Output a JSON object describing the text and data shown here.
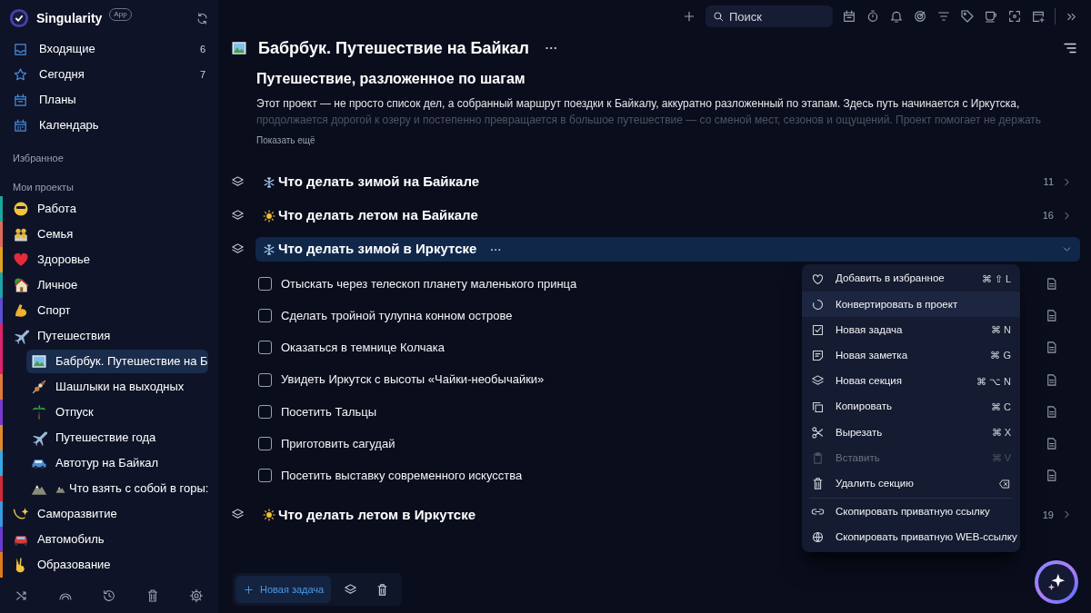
{
  "sidebar": {
    "app_name": "Singularity",
    "app_badge": "App",
    "nav": [
      {
        "label": "Входящие",
        "count": "6",
        "selected": false
      },
      {
        "label": "Сегодня",
        "count": "7",
        "selected": false
      },
      {
        "label": "Планы",
        "selected": false
      },
      {
        "label": "Календарь",
        "selected": false
      }
    ],
    "favorites_label": "Избранное",
    "projects_label": "Мои проекты",
    "projects": [
      {
        "label": "Работа",
        "color": "#19a89c",
        "selected": false
      },
      {
        "label": "Семья",
        "color": "#e06a5a",
        "selected": false
      },
      {
        "label": "Здоровье",
        "color": "#e0a21e",
        "selected": false
      },
      {
        "label": "Личное",
        "color": "#1fa3a8",
        "selected": false
      },
      {
        "label": "Спорт",
        "color": "#5a4fd0",
        "selected": false
      },
      {
        "label": "Путешествия",
        "color": "#e0216e",
        "selected": false,
        "children": [
          {
            "label": "Бабрбук. Путешествие на Б",
            "color": "#e0216e",
            "selected": true
          },
          {
            "label": "Шашлыки на выходных",
            "color": "#e07a3a",
            "selected": false
          },
          {
            "label": "Отпуск",
            "color": "#7a3ad0",
            "selected": false
          },
          {
            "label": "Путешествие года",
            "color": "#e08a2a",
            "selected": false
          },
          {
            "label": "Автотур на Байкал",
            "color": "#3aa8e0",
            "selected": false
          },
          {
            "label": "Что взять с собой в горы:",
            "color": "#d02a3a",
            "selected": false
          }
        ]
      },
      {
        "label": "Саморазвитие",
        "color": "#3a9ae0",
        "selected": false
      },
      {
        "label": "Автомобиль",
        "color": "#6a3ad0",
        "selected": false
      },
      {
        "label": "Образование",
        "color": "#e07a1a",
        "selected": false
      }
    ]
  },
  "toolbar": {
    "search": {
      "placeholder": "Поиск"
    }
  },
  "project": {
    "title": "Бабрбук. Путешествие на Байкал",
    "heading": "Путешествие, разложенное по шагам",
    "description": [
      "Этот проект — не просто список дел, а собранный маршрут поездки к Байкалу, аккуратно разложенный по этапам. Здесь путь начинается с Иркутска,",
      "продолжается дорогой к озеру и постепенно превращается в большое путешествие — со сменой мест, сезонов и ощущений. Проект помогает не держать"
    ],
    "show_more": "Показать ещё"
  },
  "sections": [
    {
      "title": "Что делать зимой на Байкале",
      "count": "11",
      "expanded": false,
      "selected": false
    },
    {
      "title": "Что делать летом на Байкале",
      "count": "16",
      "expanded": false,
      "selected": false
    },
    {
      "title": "Что делать зимой в Иркутске",
      "expanded": true,
      "selected": true,
      "tasks": [
        {
          "text": "Отыскать через телескоп планету маленького принца",
          "checked": false
        },
        {
          "text": "Сделать тройной тулупна конном острове",
          "checked": false
        },
        {
          "text": "Оказаться в темнице Колчака",
          "checked": false
        },
        {
          "text": "Увидеть Иркутск с высоты «Чайки-необычайки»",
          "checked": false
        },
        {
          "text": "Посетить Тальцы",
          "checked": false
        },
        {
          "text": "Приготовить сагудай",
          "checked": false
        },
        {
          "text": "Посетить выставку современного искусства",
          "checked": false
        }
      ]
    },
    {
      "title": "Что делать летом в Иркутске",
      "count": "19",
      "expanded": false,
      "selected": false
    }
  ],
  "context_menu": {
    "groups": [
      [
        {
          "label": "Добавить в избранное",
          "shortcut": "⌘ ⇧ L",
          "selected": false,
          "disabled": false
        },
        {
          "label": "Конвертировать в проект",
          "selected": true,
          "disabled": false
        },
        {
          "label": "Новая задача",
          "shortcut": "⌘ N",
          "selected": false,
          "disabled": false
        },
        {
          "label": "Новая заметка",
          "shortcut": "⌘ G",
          "selected": false,
          "disabled": false
        },
        {
          "label": "Новая секция",
          "shortcut": "⌘ ⌥ N",
          "selected": false,
          "disabled": false
        },
        {
          "label": "Копировать",
          "shortcut": "⌘ C",
          "selected": false,
          "disabled": false
        },
        {
          "label": "Вырезать",
          "shortcut": "⌘ X",
          "selected": false,
          "disabled": false
        },
        {
          "label": "Вставить",
          "shortcut": "⌘ V",
          "selected": false,
          "disabled": true
        },
        {
          "label": "Удалить секцию",
          "selected": false,
          "disabled": false
        }
      ],
      [
        {
          "label": "Скопировать приватную ссылку",
          "selected": false,
          "disabled": false
        },
        {
          "label": "Скопировать приватную WEB-ссылку",
          "selected": false,
          "disabled": false
        }
      ]
    ]
  },
  "bottom_bar": {
    "new_task": "Новая задача"
  }
}
